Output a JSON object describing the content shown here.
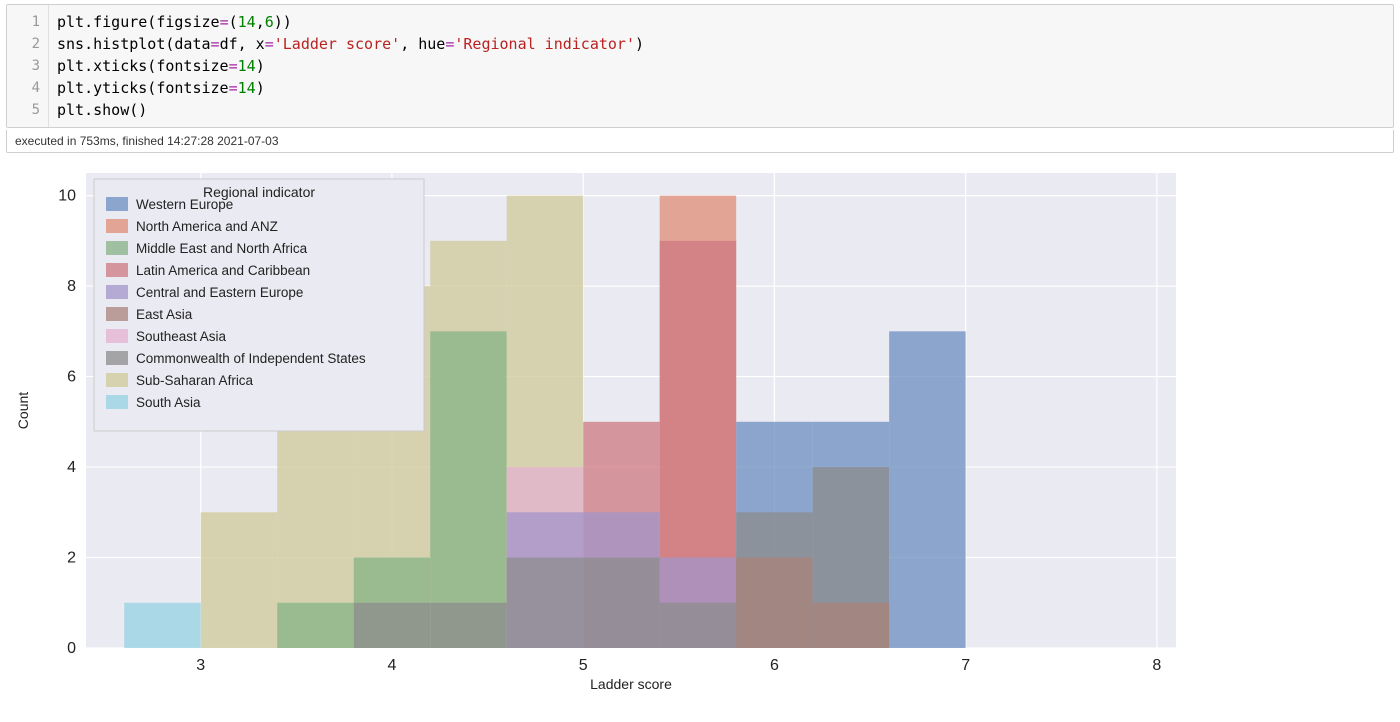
{
  "code": {
    "lines": [
      "1",
      "2",
      "3",
      "4",
      "5"
    ],
    "l1_a": "plt.figure(figsize",
    "l1_b": "14",
    "l1_c": "6",
    "l2_a": "sns.histplot(data",
    "l2_b": "df, x",
    "l2_c": "'Ladder score'",
    "l2_d": ", hue",
    "l2_e": "'Regional indicator'",
    "l3_a": "plt.xticks(fontsize",
    "l3_b": "14",
    "l4_a": "plt.yticks(fontsize",
    "l4_b": "14",
    "l5": "plt.show()",
    "eq": "=",
    "lp": "(",
    "rp": ")",
    "rpp": "))",
    "comma": ","
  },
  "exec_status": "executed in 753ms, finished 14:27:28 2021-07-03",
  "chart_data": {
    "type": "bar",
    "xlabel": "Ladder score",
    "ylabel": "Count",
    "legend_title": "Regional indicator",
    "xlim": [
      2.4,
      8.1
    ],
    "ylim": [
      0,
      10.5
    ],
    "yticks": [
      0,
      2,
      4,
      6,
      8,
      10
    ],
    "xticks": [
      3,
      4,
      5,
      6,
      7,
      8
    ],
    "bin_width": 0.4,
    "bin_edges": [
      2.6,
      3.0,
      3.4,
      3.8,
      4.2,
      4.6,
      5.0,
      5.4,
      5.8,
      6.2,
      6.6,
      7.0,
      7.4,
      7.8
    ],
    "series": [
      {
        "name": "Western Europe",
        "color": "rgba(108,142,191,0.75)"
      },
      {
        "name": "North America and ANZ",
        "color": "rgba(223,140,117,0.75)"
      },
      {
        "name": "Middle East and North Africa",
        "color": "rgba(133,178,134,0.75)"
      },
      {
        "name": "Latin America and Caribbean",
        "color": "rgba(205,120,128,0.75)"
      },
      {
        "name": "Central and Eastern Europe",
        "color": "rgba(162,148,202,0.75)"
      },
      {
        "name": "East Asia",
        "color": "rgba(169,130,121,0.75)"
      },
      {
        "name": "Southeast Asia",
        "color": "rgba(228,177,208,0.75)"
      },
      {
        "name": "Commonwealth of Independent States",
        "color": "rgba(140,140,140,0.75)"
      },
      {
        "name": "Sub-Saharan Africa",
        "color": "rgba(207,200,151,0.75)"
      },
      {
        "name": "South Asia",
        "color": "rgba(148,210,226,0.75)"
      }
    ],
    "bars": [
      {
        "bin": 0,
        "series": "South Asia",
        "value": 1
      },
      {
        "bin": 1,
        "series": "Sub-Saharan Africa",
        "value": 3
      },
      {
        "bin": 2,
        "series": "Sub-Saharan Africa",
        "value": 5
      },
      {
        "bin": 2,
        "series": "Middle East and North Africa",
        "value": 1
      },
      {
        "bin": 3,
        "series": "Sub-Saharan Africa",
        "value": 8
      },
      {
        "bin": 3,
        "series": "Middle East and North Africa",
        "value": 2
      },
      {
        "bin": 3,
        "series": "Commonwealth of Independent States",
        "value": 1
      },
      {
        "bin": 4,
        "series": "Sub-Saharan Africa",
        "value": 9
      },
      {
        "bin": 4,
        "series": "Middle East and North Africa",
        "value": 7
      },
      {
        "bin": 4,
        "series": "Commonwealth of Independent States",
        "value": 1
      },
      {
        "bin": 5,
        "series": "Sub-Saharan Africa",
        "value": 10
      },
      {
        "bin": 5,
        "series": "Southeast Asia",
        "value": 4
      },
      {
        "bin": 5,
        "series": "Central and Eastern Europe",
        "value": 3
      },
      {
        "bin": 5,
        "series": "Commonwealth of Independent States",
        "value": 2
      },
      {
        "bin": 6,
        "series": "Latin America and Caribbean",
        "value": 5
      },
      {
        "bin": 6,
        "series": "Central and Eastern Europe",
        "value": 3
      },
      {
        "bin": 6,
        "series": "Commonwealth of Independent States",
        "value": 2
      },
      {
        "bin": 7,
        "series": "North America and ANZ",
        "value": 10
      },
      {
        "bin": 7,
        "series": "Latin America and Caribbean",
        "value": 9
      },
      {
        "bin": 7,
        "series": "Central and Eastern Europe",
        "value": 2
      },
      {
        "bin": 7,
        "series": "Commonwealth of Independent States",
        "value": 1
      },
      {
        "bin": 8,
        "series": "Western Europe",
        "value": 5
      },
      {
        "bin": 8,
        "series": "Commonwealth of Independent States",
        "value": 3
      },
      {
        "bin": 8,
        "series": "East Asia",
        "value": 2
      },
      {
        "bin": 9,
        "series": "Western Europe",
        "value": 5
      },
      {
        "bin": 9,
        "series": "Commonwealth of Independent States",
        "value": 4
      },
      {
        "bin": 9,
        "series": "East Asia",
        "value": 1
      },
      {
        "bin": 10,
        "series": "Western Europe",
        "value": 7
      }
    ]
  }
}
